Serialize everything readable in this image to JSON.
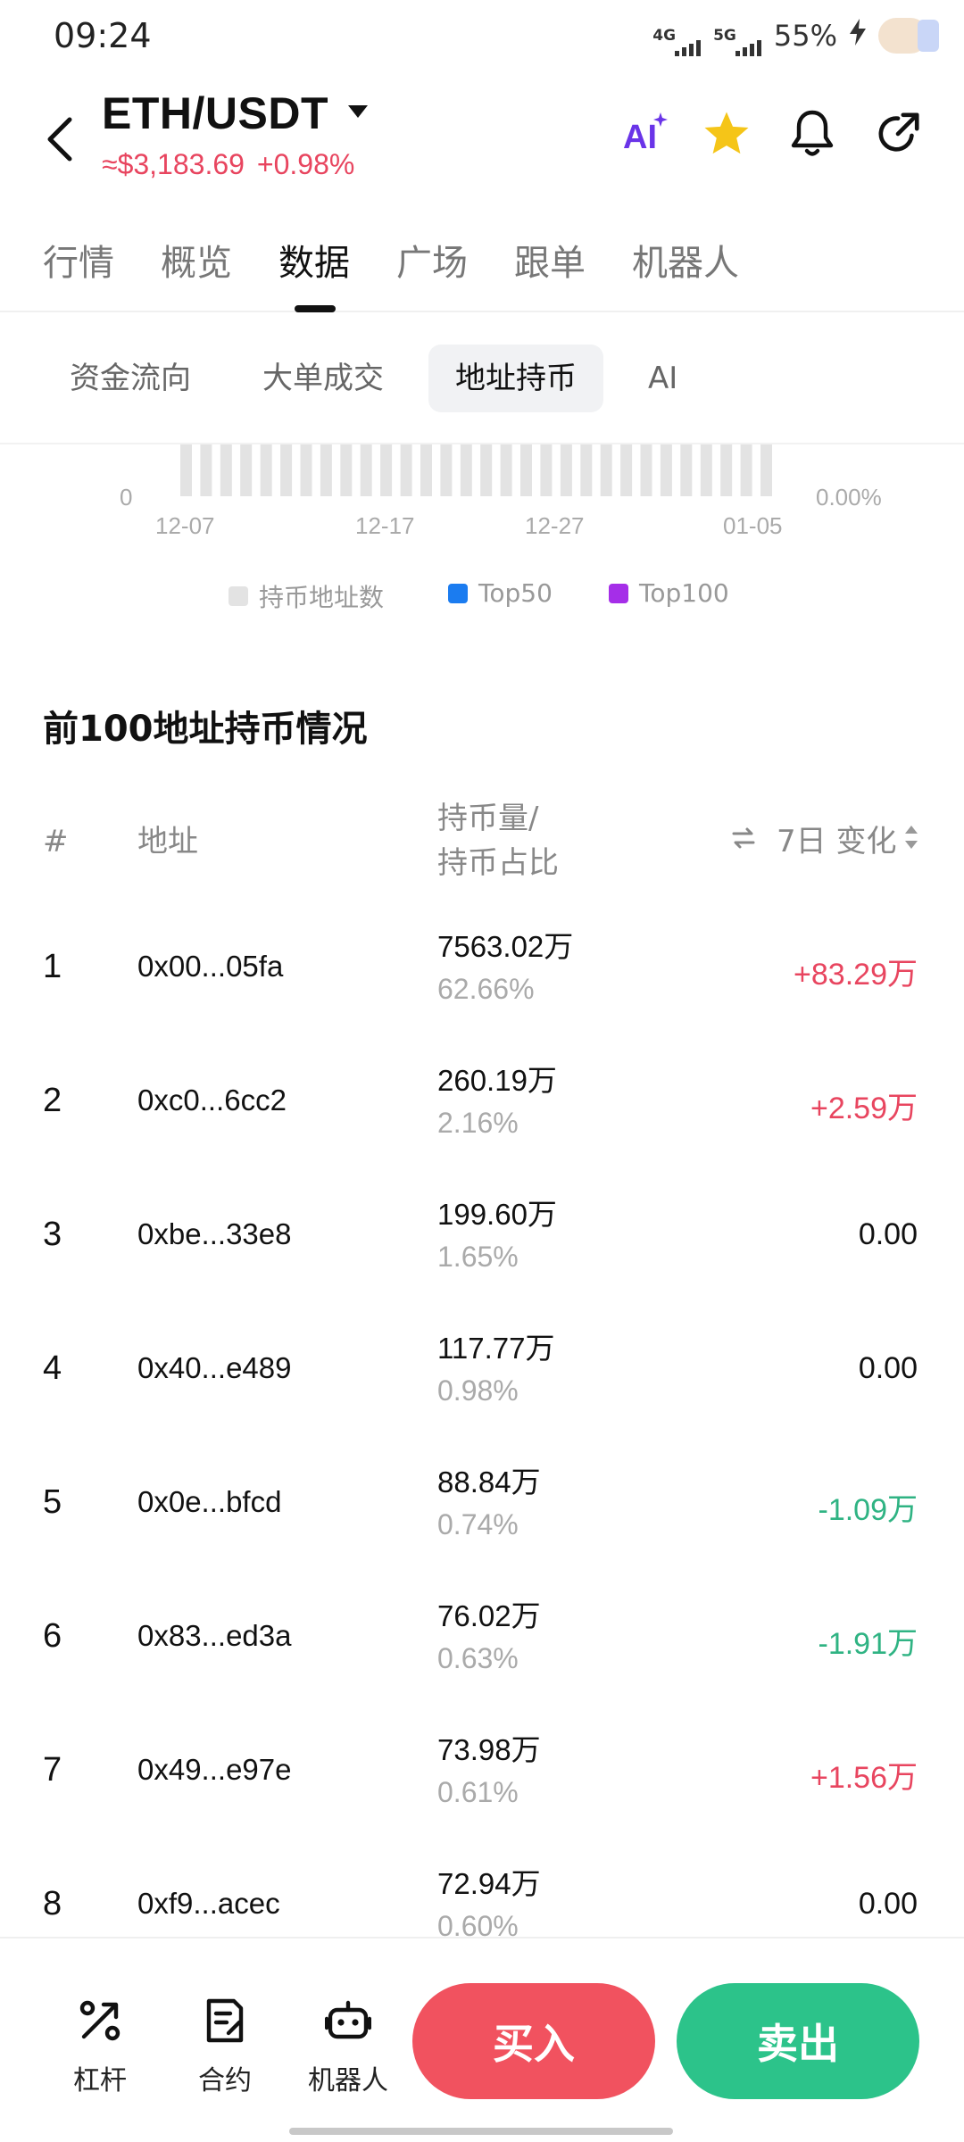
{
  "status_bar": {
    "time": "09:24",
    "network_1": "4G",
    "network_2": "5G",
    "battery": "55%"
  },
  "header": {
    "pair": "ETH/USDT",
    "price": "≈$3,183.69",
    "change": "+0.98%",
    "icons": [
      "ai-icon",
      "star-icon",
      "bell-icon",
      "share-icon"
    ],
    "colors": {
      "up": "#e8455f",
      "down": "#2fb383",
      "star": "#f5c518",
      "ai": "#6a34e8"
    }
  },
  "tabs": [
    "行情",
    "概览",
    "数据",
    "广场",
    "跟单",
    "机器人"
  ],
  "active_tab": "数据",
  "subtabs": [
    "资金流向",
    "大单成交",
    "地址持币",
    "AI"
  ],
  "active_subtab": "地址持币",
  "chart": {
    "y_left": "0",
    "y_right": "0.00%",
    "x_ticks": [
      "12-07",
      "12-17",
      "12-27",
      "01-05"
    ],
    "legend": [
      {
        "label": "持币地址数",
        "color": "#e3e3e3"
      },
      {
        "label": "Top50",
        "color": "#1b7cf0"
      },
      {
        "label": "Top100",
        "color": "#a52ee8"
      }
    ]
  },
  "section": {
    "title": "前100地址持币情况",
    "columns": {
      "rank": "#",
      "address": "地址",
      "holding_line1": "持币量/",
      "holding_line2": "持币占比",
      "change": "7日 变化"
    }
  },
  "rows": [
    {
      "rank": "1",
      "address": "0x00...05fa",
      "amount": "7563.02万",
      "percent": "62.66%",
      "change": "+83.29万",
      "dir": "up"
    },
    {
      "rank": "2",
      "address": "0xc0...6cc2",
      "amount": "260.19万",
      "percent": "2.16%",
      "change": "+2.59万",
      "dir": "up"
    },
    {
      "rank": "3",
      "address": "0xbe...33e8",
      "amount": "199.60万",
      "percent": "1.65%",
      "change": "0.00",
      "dir": "flat"
    },
    {
      "rank": "4",
      "address": "0x40...e489",
      "amount": "117.77万",
      "percent": "0.98%",
      "change": "0.00",
      "dir": "flat"
    },
    {
      "rank": "5",
      "address": "0x0e...bfcd",
      "amount": "88.84万",
      "percent": "0.74%",
      "change": "-1.09万",
      "dir": "down"
    },
    {
      "rank": "6",
      "address": "0x83...ed3a",
      "amount": "76.02万",
      "percent": "0.63%",
      "change": "-1.91万",
      "dir": "down"
    },
    {
      "rank": "7",
      "address": "0x49...e97e",
      "amount": "73.98万",
      "percent": "0.61%",
      "change": "+1.56万",
      "dir": "up"
    },
    {
      "rank": "8",
      "address": "0xf9...acec",
      "amount": "72.94万",
      "percent": "0.60%",
      "change": "0.00",
      "dir": "flat"
    }
  ],
  "bottom_bar": {
    "items": [
      "杠杆",
      "合约",
      "机器人"
    ],
    "buy": "买入",
    "sell": "卖出"
  }
}
